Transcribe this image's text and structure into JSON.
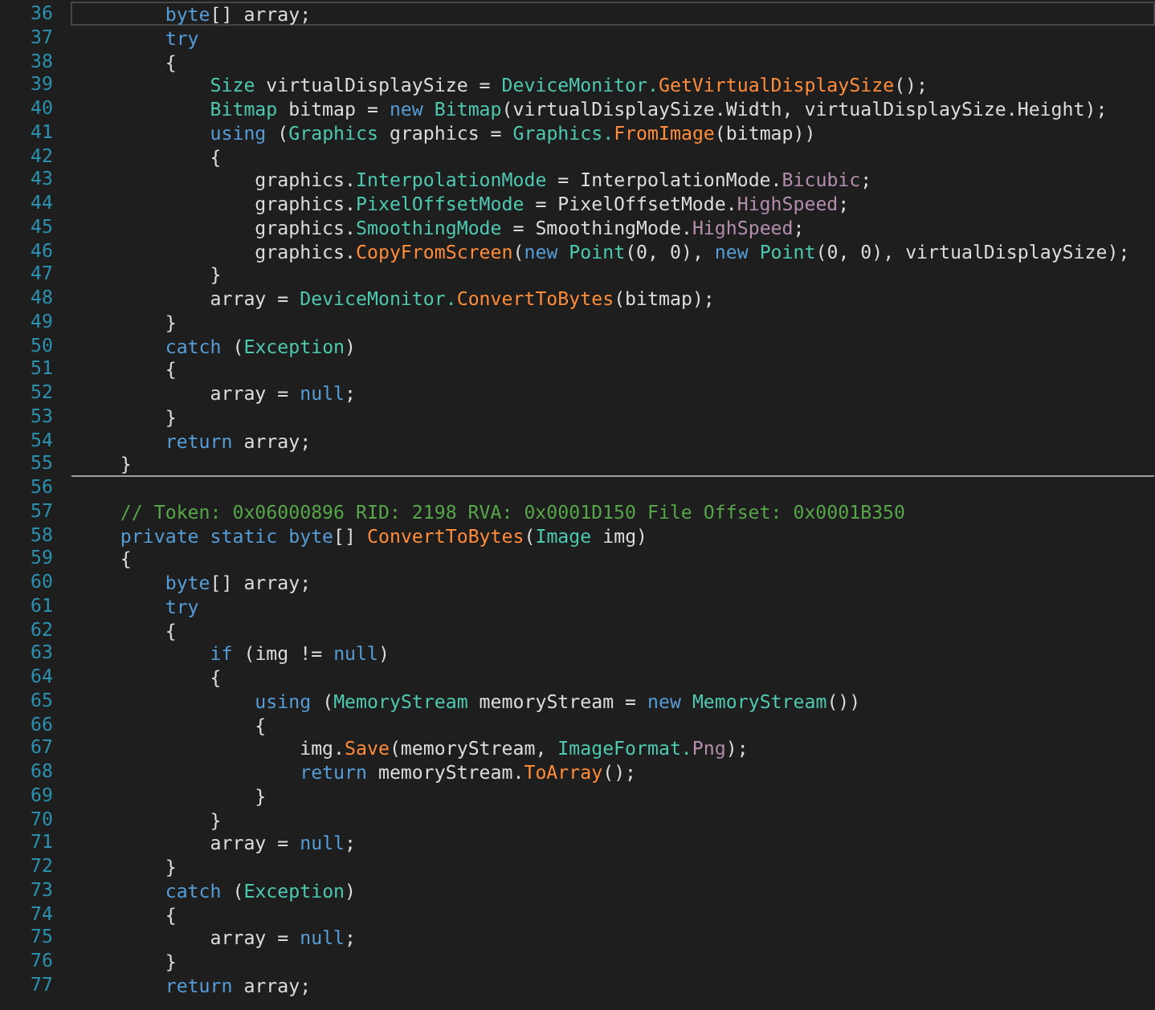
{
  "editor": {
    "lines": [
      {
        "number": "36",
        "current": true,
        "separator": false,
        "tokens": [
          {
            "kind": "keyword",
            "text": "        byte"
          },
          {
            "kind": "plain",
            "text": "[] array;"
          }
        ]
      },
      {
        "number": "37",
        "current": false,
        "separator": false,
        "tokens": [
          {
            "kind": "keyword",
            "text": "        try"
          }
        ]
      },
      {
        "number": "38",
        "current": false,
        "separator": false,
        "tokens": [
          {
            "kind": "plain",
            "text": "        {"
          }
        ]
      },
      {
        "number": "39",
        "current": false,
        "separator": false,
        "tokens": [
          {
            "kind": "type",
            "text": "            Size"
          },
          {
            "kind": "plain",
            "text": " virtualDisplaySize = "
          },
          {
            "kind": "type",
            "text": "DeviceMonitor."
          },
          {
            "kind": "method",
            "text": "GetVirtualDisplaySize"
          },
          {
            "kind": "plain",
            "text": "();"
          }
        ]
      },
      {
        "number": "40",
        "current": false,
        "separator": false,
        "tokens": [
          {
            "kind": "type",
            "text": "            Bitmap"
          },
          {
            "kind": "plain",
            "text": " bitmap = "
          },
          {
            "kind": "keyword",
            "text": "new "
          },
          {
            "kind": "type",
            "text": "Bitmap"
          },
          {
            "kind": "plain",
            "text": "(virtualDisplaySize.Width, virtualDisplaySize.Height);"
          }
        ]
      },
      {
        "number": "41",
        "current": false,
        "separator": false,
        "tokens": [
          {
            "kind": "keyword",
            "text": "            using"
          },
          {
            "kind": "plain",
            "text": " ("
          },
          {
            "kind": "type",
            "text": "Graphics"
          },
          {
            "kind": "plain",
            "text": " graphics = "
          },
          {
            "kind": "type",
            "text": "Graphics."
          },
          {
            "kind": "method",
            "text": "FromImage"
          },
          {
            "kind": "plain",
            "text": "(bitmap))"
          }
        ]
      },
      {
        "number": "42",
        "current": false,
        "separator": false,
        "tokens": [
          {
            "kind": "plain",
            "text": "            {"
          }
        ]
      },
      {
        "number": "43",
        "current": false,
        "separator": false,
        "tokens": [
          {
            "kind": "plain",
            "text": "                graphics."
          },
          {
            "kind": "property",
            "text": "InterpolationMode"
          },
          {
            "kind": "plain",
            "text": " = InterpolationMode."
          },
          {
            "kind": "enum",
            "text": "Bicubic"
          },
          {
            "kind": "plain",
            "text": ";"
          }
        ]
      },
      {
        "number": "44",
        "current": false,
        "separator": false,
        "tokens": [
          {
            "kind": "plain",
            "text": "                graphics."
          },
          {
            "kind": "property",
            "text": "PixelOffsetMode"
          },
          {
            "kind": "plain",
            "text": " = PixelOffsetMode."
          },
          {
            "kind": "enum",
            "text": "HighSpeed"
          },
          {
            "kind": "plain",
            "text": ";"
          }
        ]
      },
      {
        "number": "45",
        "current": false,
        "separator": false,
        "tokens": [
          {
            "kind": "plain",
            "text": "                graphics."
          },
          {
            "kind": "property",
            "text": "SmoothingMode"
          },
          {
            "kind": "plain",
            "text": " = SmoothingMode."
          },
          {
            "kind": "enum",
            "text": "HighSpeed"
          },
          {
            "kind": "plain",
            "text": ";"
          }
        ]
      },
      {
        "number": "46",
        "current": false,
        "separator": false,
        "tokens": [
          {
            "kind": "plain",
            "text": "                graphics."
          },
          {
            "kind": "method",
            "text": "CopyFromScreen"
          },
          {
            "kind": "plain",
            "text": "("
          },
          {
            "kind": "keyword",
            "text": "new "
          },
          {
            "kind": "type",
            "text": "Point"
          },
          {
            "kind": "plain",
            "text": "(0, 0), "
          },
          {
            "kind": "keyword",
            "text": "new "
          },
          {
            "kind": "type",
            "text": "Point"
          },
          {
            "kind": "plain",
            "text": "(0, 0), virtualDisplaySize);"
          }
        ]
      },
      {
        "number": "47",
        "current": false,
        "separator": false,
        "tokens": [
          {
            "kind": "plain",
            "text": "            }"
          }
        ]
      },
      {
        "number": "48",
        "current": false,
        "separator": false,
        "tokens": [
          {
            "kind": "plain",
            "text": "            array = "
          },
          {
            "kind": "type",
            "text": "DeviceMonitor."
          },
          {
            "kind": "method",
            "text": "ConvertToBytes"
          },
          {
            "kind": "plain",
            "text": "(bitmap);"
          }
        ]
      },
      {
        "number": "49",
        "current": false,
        "separator": false,
        "tokens": [
          {
            "kind": "plain",
            "text": "        }"
          }
        ]
      },
      {
        "number": "50",
        "current": false,
        "separator": false,
        "tokens": [
          {
            "kind": "keyword",
            "text": "        catch"
          },
          {
            "kind": "plain",
            "text": " ("
          },
          {
            "kind": "type",
            "text": "Exception"
          },
          {
            "kind": "plain",
            "text": ")"
          }
        ]
      },
      {
        "number": "51",
        "current": false,
        "separator": false,
        "tokens": [
          {
            "kind": "plain",
            "text": "        {"
          }
        ]
      },
      {
        "number": "52",
        "current": false,
        "separator": false,
        "tokens": [
          {
            "kind": "plain",
            "text": "            array = "
          },
          {
            "kind": "keyword",
            "text": "null"
          },
          {
            "kind": "plain",
            "text": ";"
          }
        ]
      },
      {
        "number": "53",
        "current": false,
        "separator": false,
        "tokens": [
          {
            "kind": "plain",
            "text": "        }"
          }
        ]
      },
      {
        "number": "54",
        "current": false,
        "separator": false,
        "tokens": [
          {
            "kind": "keyword",
            "text": "        return"
          },
          {
            "kind": "plain",
            "text": " array;"
          }
        ]
      },
      {
        "number": "55",
        "current": false,
        "separator": false,
        "tokens": [
          {
            "kind": "plain",
            "text": "    }"
          }
        ]
      },
      {
        "number": "56",
        "current": false,
        "separator": true
      },
      {
        "number": "57",
        "current": false,
        "separator": false,
        "tokens": [
          {
            "kind": "comment",
            "text": "    // Token: 0x06000896 RID: 2198 RVA: 0x0001D150 File Offset: 0x0001B350"
          }
        ]
      },
      {
        "number": "58",
        "current": false,
        "separator": false,
        "tokens": [
          {
            "kind": "keyword",
            "text": "    private static byte"
          },
          {
            "kind": "plain",
            "text": "[] "
          },
          {
            "kind": "method",
            "text": "ConvertToBytes"
          },
          {
            "kind": "plain",
            "text": "("
          },
          {
            "kind": "type",
            "text": "Image"
          },
          {
            "kind": "plain",
            "text": " img)"
          }
        ]
      },
      {
        "number": "59",
        "current": false,
        "separator": false,
        "tokens": [
          {
            "kind": "plain",
            "text": "    {"
          }
        ]
      },
      {
        "number": "60",
        "current": false,
        "separator": false,
        "tokens": [
          {
            "kind": "keyword",
            "text": "        byte"
          },
          {
            "kind": "plain",
            "text": "[] array;"
          }
        ]
      },
      {
        "number": "61",
        "current": false,
        "separator": false,
        "tokens": [
          {
            "kind": "keyword",
            "text": "        try"
          }
        ]
      },
      {
        "number": "62",
        "current": false,
        "separator": false,
        "tokens": [
          {
            "kind": "plain",
            "text": "        {"
          }
        ]
      },
      {
        "number": "63",
        "current": false,
        "separator": false,
        "tokens": [
          {
            "kind": "keyword",
            "text": "            if"
          },
          {
            "kind": "plain",
            "text": " (img != "
          },
          {
            "kind": "keyword",
            "text": "null"
          },
          {
            "kind": "plain",
            "text": ")"
          }
        ]
      },
      {
        "number": "64",
        "current": false,
        "separator": false,
        "tokens": [
          {
            "kind": "plain",
            "text": "            {"
          }
        ]
      },
      {
        "number": "65",
        "current": false,
        "separator": false,
        "tokens": [
          {
            "kind": "keyword",
            "text": "                using"
          },
          {
            "kind": "plain",
            "text": " ("
          },
          {
            "kind": "type",
            "text": "MemoryStream"
          },
          {
            "kind": "plain",
            "text": " memoryStream = "
          },
          {
            "kind": "keyword",
            "text": "new "
          },
          {
            "kind": "type",
            "text": "MemoryStream"
          },
          {
            "kind": "plain",
            "text": "())"
          }
        ]
      },
      {
        "number": "66",
        "current": false,
        "separator": false,
        "tokens": [
          {
            "kind": "plain",
            "text": "                {"
          }
        ]
      },
      {
        "number": "67",
        "current": false,
        "separator": false,
        "tokens": [
          {
            "kind": "plain",
            "text": "                    img."
          },
          {
            "kind": "method",
            "text": "Save"
          },
          {
            "kind": "plain",
            "text": "(memoryStream, "
          },
          {
            "kind": "type",
            "text": "ImageFormat."
          },
          {
            "kind": "enum",
            "text": "Png"
          },
          {
            "kind": "plain",
            "text": ");"
          }
        ]
      },
      {
        "number": "68",
        "current": false,
        "separator": false,
        "tokens": [
          {
            "kind": "keyword",
            "text": "                    return"
          },
          {
            "kind": "plain",
            "text": " memoryStream."
          },
          {
            "kind": "method",
            "text": "ToArray"
          },
          {
            "kind": "plain",
            "text": "();"
          }
        ]
      },
      {
        "number": "69",
        "current": false,
        "separator": false,
        "tokens": [
          {
            "kind": "plain",
            "text": "                }"
          }
        ]
      },
      {
        "number": "70",
        "current": false,
        "separator": false,
        "tokens": [
          {
            "kind": "plain",
            "text": "            }"
          }
        ]
      },
      {
        "number": "71",
        "current": false,
        "separator": false,
        "tokens": [
          {
            "kind": "plain",
            "text": "            array = "
          },
          {
            "kind": "keyword",
            "text": "null"
          },
          {
            "kind": "plain",
            "text": ";"
          }
        ]
      },
      {
        "number": "72",
        "current": false,
        "separator": false,
        "tokens": [
          {
            "kind": "plain",
            "text": "        }"
          }
        ]
      },
      {
        "number": "73",
        "current": false,
        "separator": false,
        "tokens": [
          {
            "kind": "keyword",
            "text": "        catch"
          },
          {
            "kind": "plain",
            "text": " ("
          },
          {
            "kind": "type",
            "text": "Exception"
          },
          {
            "kind": "plain",
            "text": ")"
          }
        ]
      },
      {
        "number": "74",
        "current": false,
        "separator": false,
        "tokens": [
          {
            "kind": "plain",
            "text": "        {"
          }
        ]
      },
      {
        "number": "75",
        "current": false,
        "separator": false,
        "tokens": [
          {
            "kind": "plain",
            "text": "            array = "
          },
          {
            "kind": "keyword",
            "text": "null"
          },
          {
            "kind": "plain",
            "text": ";"
          }
        ]
      },
      {
        "number": "76",
        "current": false,
        "separator": false,
        "tokens": [
          {
            "kind": "plain",
            "text": "        }"
          }
        ]
      },
      {
        "number": "77",
        "current": false,
        "separator": false,
        "tokens": [
          {
            "kind": "keyword",
            "text": "        return"
          },
          {
            "kind": "plain",
            "text": " array;"
          }
        ]
      }
    ]
  }
}
